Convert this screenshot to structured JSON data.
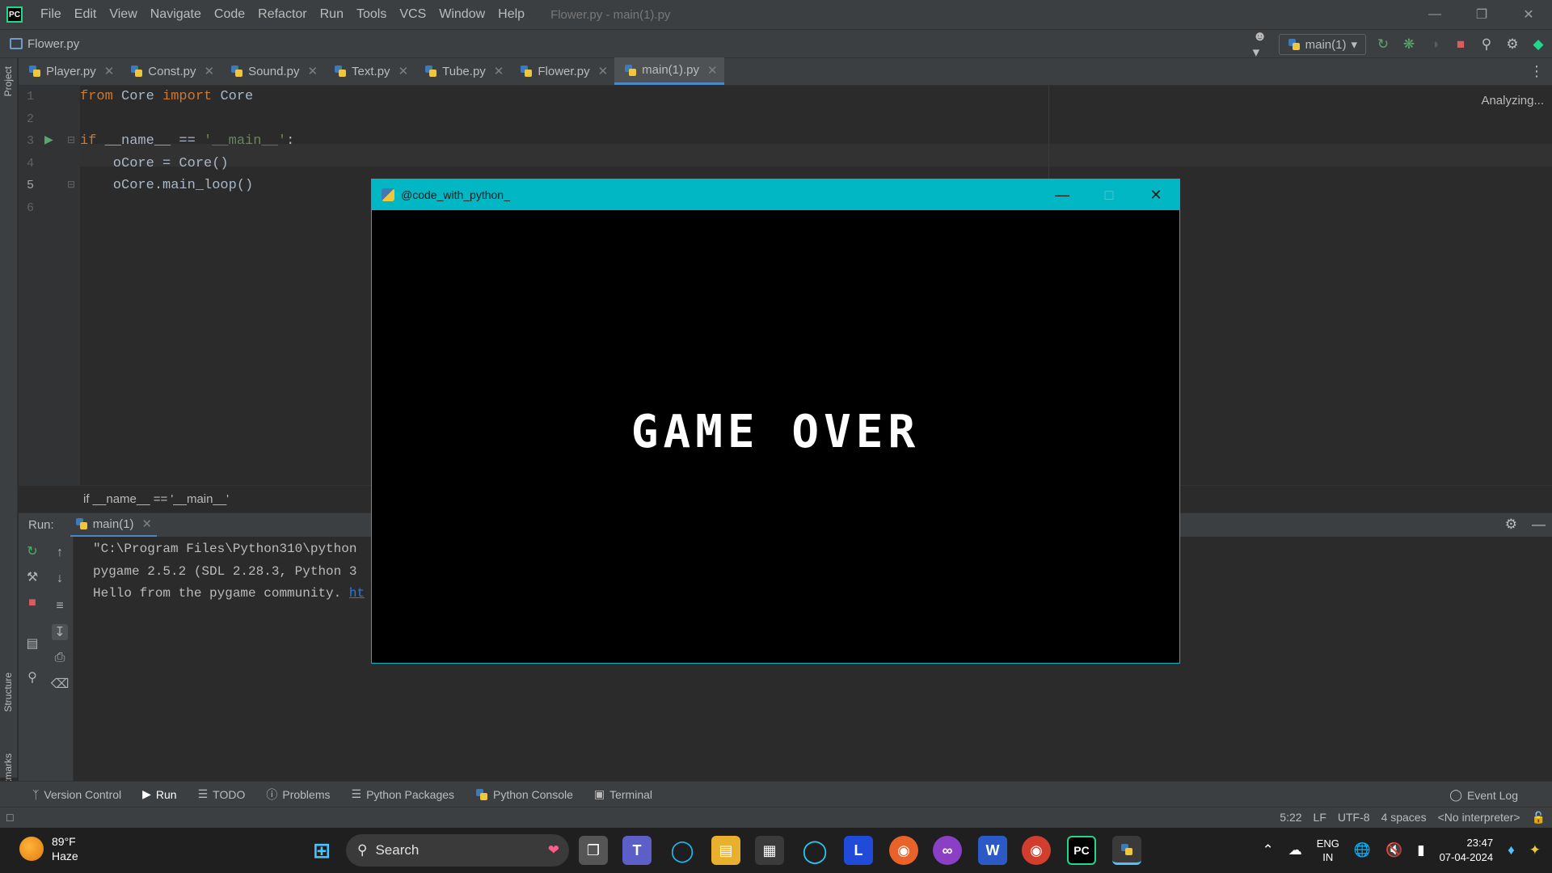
{
  "ide": {
    "menu": [
      "File",
      "Edit",
      "View",
      "Navigate",
      "Code",
      "Refactor",
      "Run",
      "Tools",
      "VCS",
      "Window",
      "Help"
    ],
    "window_title": "Flower.py - main(1).py",
    "nav_file": "Flower.py",
    "run_config": "main(1)",
    "tabs": [
      "Player.py",
      "Const.py",
      "Sound.py",
      "Text.py",
      "Tube.py",
      "Flower.py",
      "main(1).py"
    ],
    "active_tab": "main(1).py",
    "analyzing": "Analyzing...",
    "left_strip": {
      "project": "Project",
      "structure": "Structure",
      "bookmarks": "Bookmarks"
    },
    "code": {
      "line_numbers": [
        "1",
        "2",
        "3",
        "4",
        "5",
        "6"
      ],
      "line1_kw1": "from",
      "line1_mid": " Core ",
      "line1_kw2": "import",
      "line1_end": " Core",
      "line3_kw": "if",
      "line3_mid": " __name__ == ",
      "line3_str": "'__main__'",
      "line3_end": ":",
      "line4": "    oCore = Core()",
      "line5": "    oCore.main_loop()"
    },
    "breadcrumb": "if __name__ == '__main__'",
    "run_panel": {
      "label": "Run:",
      "tab": "main(1)",
      "console": [
        "\"C:\\Program Files\\Python310\\python",
        "pygame 2.5.2 (SDL 2.28.3, Python 3",
        "Hello from the pygame community. "
      ],
      "console_link": "ht"
    },
    "tool_windows": [
      "Version Control",
      "Run",
      "TODO",
      "Problems",
      "Python Packages",
      "Python Console",
      "Terminal"
    ],
    "event_log": "Event Log",
    "status": {
      "position": "5:22",
      "line_sep": "LF",
      "encoding": "UTF-8",
      "indent": "4 spaces",
      "interpreter": "<No interpreter>"
    }
  },
  "game_window": {
    "title": "@code_with_python_",
    "text": "GAME OVER",
    "titlebar_color": "#00b7c3"
  },
  "taskbar": {
    "weather_temp": "89°F",
    "weather_desc": "Haze",
    "search": "Search",
    "lang1": "ENG",
    "lang2": "IN",
    "time": "23:47",
    "date": "07-04-2024"
  }
}
